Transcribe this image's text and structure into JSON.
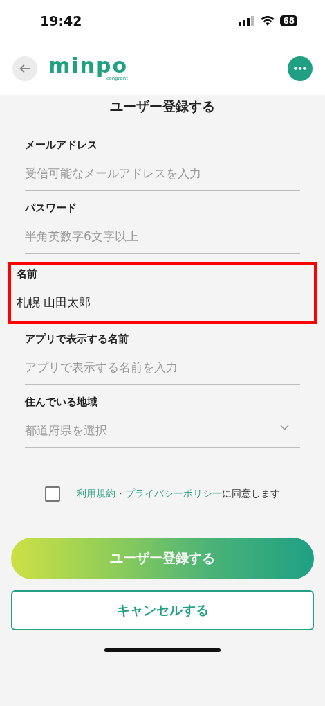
{
  "status_bar": {
    "time": "19:42",
    "battery": "68"
  },
  "header": {
    "logo": "minpo",
    "logo_sub": "congrant"
  },
  "title": "ユーザー登録する",
  "fields": [
    {
      "kind": "text",
      "label": "メールアドレス",
      "placeholder": "受信可能なメールアドレスを入力"
    },
    {
      "kind": "text",
      "label": "パスワード",
      "placeholder": "半角英数字6文字以上"
    },
    {
      "kind": "text",
      "label": "名前",
      "value": "札幌 山田太郎",
      "highlighted": true
    },
    {
      "kind": "text",
      "label": "アプリで表示する名前",
      "placeholder": "アプリで表示する名前を入力"
    },
    {
      "kind": "select",
      "label": "住んでいる地域",
      "placeholder": "都道府県を選択"
    }
  ],
  "agreement": {
    "checked": false,
    "terms_link": "利用規約",
    "separator": "・",
    "privacy_link": "プライバシーポリシー",
    "text": "に同意します"
  },
  "buttons": {
    "submit": "ユーザー登録する",
    "cancel": "キャンセルする"
  }
}
